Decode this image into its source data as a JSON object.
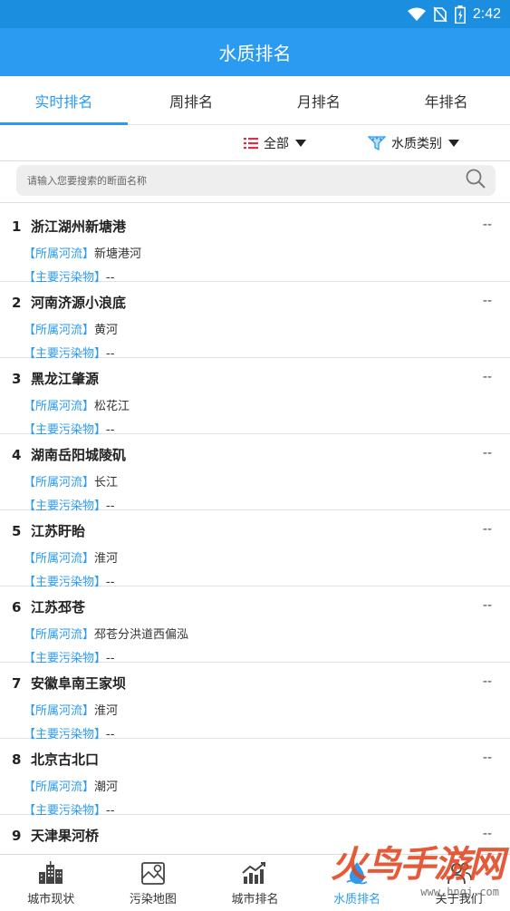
{
  "status_bar": {
    "time": "2:42"
  },
  "app_bar": {
    "title": "水质排名"
  },
  "tabs": [
    {
      "label": "实时排名",
      "active": true
    },
    {
      "label": "周排名",
      "active": false
    },
    {
      "label": "月排名",
      "active": false
    },
    {
      "label": "年排名",
      "active": false
    }
  ],
  "filters": {
    "scope": {
      "label": "全部",
      "icon": "list-icon"
    },
    "category": {
      "label": "水质类别",
      "icon": "funnel-icon"
    }
  },
  "search": {
    "placeholder": "请输入您要搜索的断面名称",
    "value": ""
  },
  "labels": {
    "river": "【所属河流】",
    "pollutant": "【主要污染物】"
  },
  "stations": [
    {
      "rank": "1",
      "name": "浙江湖州新塘港",
      "river": "新塘港河",
      "pollutant": "--",
      "grade": "--"
    },
    {
      "rank": "2",
      "name": "河南济源小浪底",
      "river": "黄河",
      "pollutant": "--",
      "grade": "--"
    },
    {
      "rank": "3",
      "name": "黑龙江肇源",
      "river": "松花江",
      "pollutant": "--",
      "grade": "--"
    },
    {
      "rank": "4",
      "name": "湖南岳阳城陵矶",
      "river": "长江",
      "pollutant": "--",
      "grade": "--"
    },
    {
      "rank": "5",
      "name": "江苏盱眙",
      "river": "淮河",
      "pollutant": "--",
      "grade": "--"
    },
    {
      "rank": "6",
      "name": "江苏邳苍",
      "river": "邳苍分洪道西偏泓",
      "pollutant": "--",
      "grade": "--"
    },
    {
      "rank": "7",
      "name": "安徽阜南王家坝",
      "river": "淮河",
      "pollutant": "--",
      "grade": "--"
    },
    {
      "rank": "8",
      "name": "北京古北口",
      "river": "潮河",
      "pollutant": "--",
      "grade": "--"
    },
    {
      "rank": "9",
      "name": "天津果河桥",
      "river": "",
      "pollutant": "",
      "grade": "--"
    }
  ],
  "bottom_nav": [
    {
      "label": "城市现状",
      "icon": "city-buildings-icon",
      "active": false
    },
    {
      "label": "污染地图",
      "icon": "map-pin-icon",
      "active": false
    },
    {
      "label": "城市排名",
      "icon": "bar-trend-icon",
      "active": false
    },
    {
      "label": "水质排名",
      "icon": "water-drop-icon",
      "active": true
    },
    {
      "label": "关于我们",
      "icon": "people-icon",
      "active": false
    }
  ],
  "watermark": {
    "text": "火鸟手游网",
    "url": "www.hnqj.com"
  },
  "colors": {
    "primary": "#2a9bf0",
    "status_bar": "#1b8ee0",
    "filter_icon": "#d9304a"
  }
}
